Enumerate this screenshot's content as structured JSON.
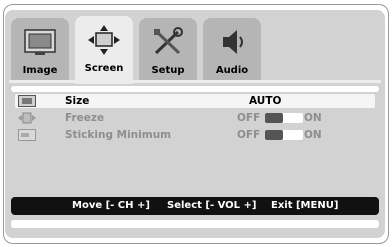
{
  "tabs": [
    {
      "label": "Image",
      "icon": "monitor-icon",
      "active": false
    },
    {
      "label": "Screen",
      "icon": "move-arrows-icon",
      "active": true
    },
    {
      "label": "Setup",
      "icon": "tools-icon",
      "active": false
    },
    {
      "label": "Audio",
      "icon": "speaker-icon",
      "active": false
    }
  ],
  "items": [
    {
      "label": "Size",
      "value": "AUTO",
      "icon": "aspect-size-icon",
      "enabled": true,
      "selected": true
    },
    {
      "label": "Freeze",
      "off": "OFF",
      "on": "ON",
      "icon": "freeze-icon",
      "enabled": false
    },
    {
      "label": "Sticking Minimum",
      "off": "OFF",
      "on": "ON",
      "icon": "sticking-minimum-icon",
      "enabled": false
    }
  ],
  "footer": {
    "move": "Move [- CH +]",
    "select": "Select [- VOL +]",
    "exit": "Exit [MENU]"
  },
  "colors": {
    "panel": "#d2d2d2",
    "active_tab": "#ececec",
    "inactive_tab": "#b5b5b5",
    "footer": "#111111",
    "disabled_text": "#8e8e8e"
  }
}
